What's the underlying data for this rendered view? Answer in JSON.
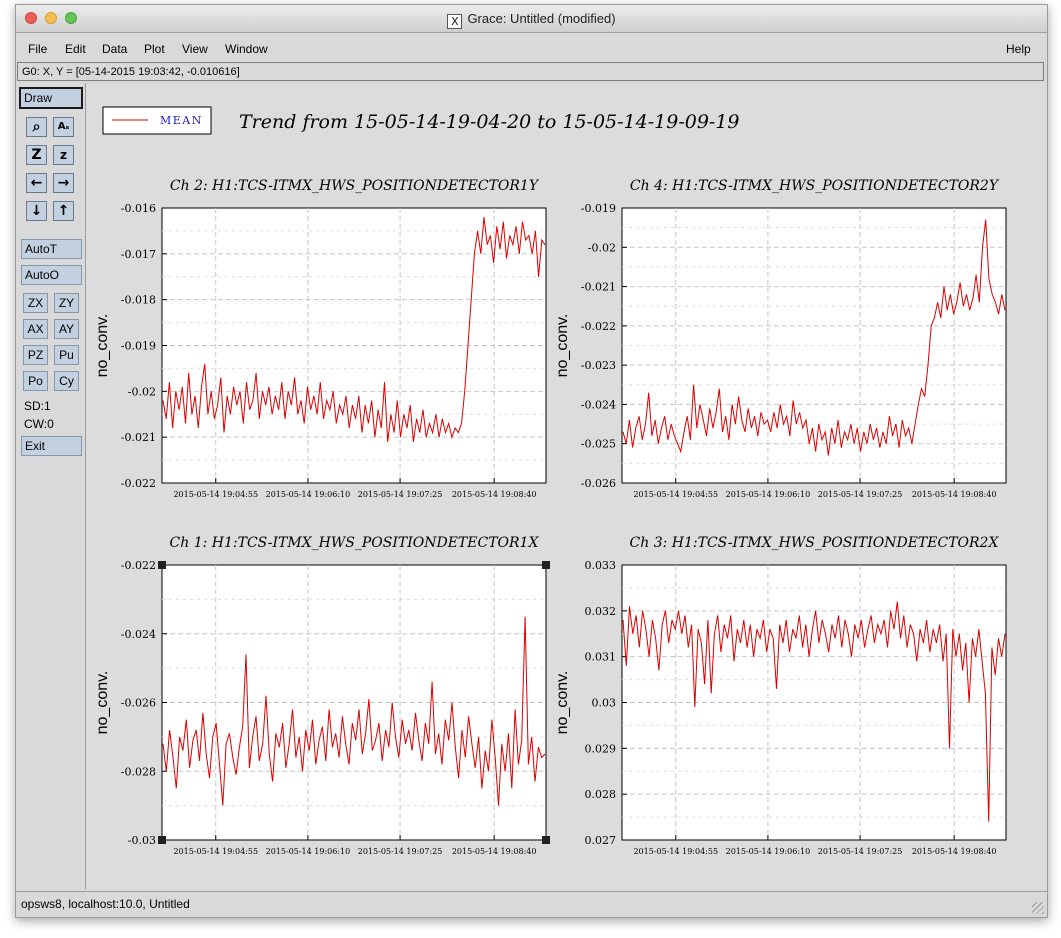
{
  "window": {
    "title": "Grace: Untitled (modified)"
  },
  "menu": {
    "file": "File",
    "edit": "Edit",
    "data": "Data",
    "plot": "Plot",
    "view": "View",
    "window": "Window",
    "help": "Help"
  },
  "coord_readout": "G0: X, Y = [05-14-2015 19:03:42, -0.010616]",
  "toolbar": {
    "draw": "Draw",
    "icons": [
      "zoom-icon",
      "autoscale-text-icon",
      "zoom-z-icon",
      "zoom-z-small-icon",
      "arrow-left-icon",
      "arrow-right-icon",
      "arrow-down-icon",
      "arrow-up-icon"
    ],
    "autot": "AutoT",
    "autoo": "AutoO",
    "zx": "ZX",
    "zy": "ZY",
    "ax": "AX",
    "ay": "AY",
    "pz": "PZ",
    "pu": "Pu",
    "po": "Po",
    "cy": "Cy",
    "sd": "SD:1",
    "cw": "CW:0",
    "exit": "Exit"
  },
  "legend": {
    "entry": "MEAN",
    "line_color": "#cc0000"
  },
  "page_title": "Trend from 15-05-14-19-04-20 to 15-05-14-19-09-19",
  "status": "opsws8, localhost:10.0, Untitled",
  "colors": {
    "series": "#dd0000",
    "legend_text": "#1a1acc",
    "button": "#c2d0e0"
  },
  "chart_data": [
    {
      "type": "line",
      "title": "Ch 2: H1:TCS-ITMX_HWS_POSITIONDETECTOR1Y",
      "ylabel": "no_conv.",
      "ylim": [
        -0.022,
        -0.016
      ],
      "yticks": [
        "-0.016",
        "-0.017",
        "-0.018",
        "-0.019",
        "-0.02",
        "-0.021",
        "-0.022"
      ],
      "xticks": [
        "2015-05-14 19:04:55",
        "2015-05-14 19:06:10",
        "2015-05-14 19:07:25",
        "2015-05-14 19:08:40"
      ],
      "series": [
        {
          "values": [
            -0.0202,
            -0.0206,
            -0.0198,
            -0.0208,
            -0.02,
            -0.0204,
            -0.0199,
            -0.0207,
            -0.0196,
            -0.0205,
            -0.0201,
            -0.0208,
            -0.0199,
            -0.0194,
            -0.0205,
            -0.02,
            -0.0206,
            -0.0203,
            -0.0197,
            -0.0209,
            -0.0201,
            -0.0205,
            -0.0199,
            -0.0203,
            -0.02,
            -0.0207,
            -0.0198,
            -0.0204,
            -0.0202,
            -0.0196,
            -0.0206,
            -0.02,
            -0.0203,
            -0.0199,
            -0.0205,
            -0.0201,
            -0.0204,
            -0.0198,
            -0.0206,
            -0.02,
            -0.0203,
            -0.0197,
            -0.0205,
            -0.0202,
            -0.0207,
            -0.0199,
            -0.0204,
            -0.0201,
            -0.0205,
            -0.0198,
            -0.0206,
            -0.0202,
            -0.0204,
            -0.02,
            -0.0207,
            -0.0203,
            -0.0205,
            -0.0201,
            -0.0208,
            -0.0203,
            -0.0206,
            -0.0201,
            -0.0209,
            -0.0203,
            -0.0207,
            -0.0202,
            -0.021,
            -0.0204,
            -0.0208,
            -0.0198,
            -0.0211,
            -0.0205,
            -0.0209,
            -0.0202,
            -0.021,
            -0.0205,
            -0.0208,
            -0.0203,
            -0.0211,
            -0.0206,
            -0.0209,
            -0.0204,
            -0.021,
            -0.0207,
            -0.0209,
            -0.0205,
            -0.021,
            -0.0206,
            -0.0209,
            -0.0207,
            -0.021,
            -0.0208,
            -0.0209,
            -0.0207,
            -0.02,
            -0.019,
            -0.018,
            -0.017,
            -0.0165,
            -0.017,
            -0.0162,
            -0.0168,
            -0.0166,
            -0.0172,
            -0.0164,
            -0.0169,
            -0.0163,
            -0.0171,
            -0.0166,
            -0.0168,
            -0.0164,
            -0.017,
            -0.0163,
            -0.0167,
            -0.0166,
            -0.017,
            -0.0165,
            -0.0175,
            -0.0167,
            -0.0168
          ]
        }
      ]
    },
    {
      "type": "line",
      "title": "Ch 4: H1:TCS-ITMX_HWS_POSITIONDETECTOR2Y",
      "ylabel": "no_conv.",
      "ylim": [
        -0.026,
        -0.019
      ],
      "yticks": [
        "-0.019",
        "-0.02",
        "-0.021",
        "-0.022",
        "-0.023",
        "-0.024",
        "-0.025",
        "-0.026"
      ],
      "xticks": [
        "2015-05-14 19:04:55",
        "2015-05-14 19:06:10",
        "2015-05-14 19:07:25",
        "2015-05-14 19:08:40"
      ],
      "series": [
        {
          "values": [
            -0.0247,
            -0.025,
            -0.0244,
            -0.0251,
            -0.0246,
            -0.0243,
            -0.0249,
            -0.0245,
            -0.0237,
            -0.0248,
            -0.0244,
            -0.025,
            -0.0246,
            -0.0243,
            -0.0249,
            -0.0245,
            -0.0248,
            -0.025,
            -0.0252,
            -0.0247,
            -0.0243,
            -0.0249,
            -0.0235,
            -0.0246,
            -0.024,
            -0.0244,
            -0.0248,
            -0.0241,
            -0.0246,
            -0.0242,
            -0.0236,
            -0.0247,
            -0.0243,
            -0.0249,
            -0.024,
            -0.0245,
            -0.0238,
            -0.0244,
            -0.0247,
            -0.0241,
            -0.0246,
            -0.0243,
            -0.0248,
            -0.0242,
            -0.0245,
            -0.0244,
            -0.0247,
            -0.0242,
            -0.0246,
            -0.024,
            -0.0245,
            -0.0243,
            -0.0248,
            -0.0239,
            -0.0245,
            -0.0242,
            -0.0246,
            -0.0244,
            -0.025,
            -0.0246,
            -0.0252,
            -0.0245,
            -0.0249,
            -0.0247,
            -0.0253,
            -0.0246,
            -0.025,
            -0.0244,
            -0.0251,
            -0.0247,
            -0.0249,
            -0.0245,
            -0.025,
            -0.0246,
            -0.0252,
            -0.0247,
            -0.025,
            -0.0245,
            -0.0249,
            -0.0246,
            -0.0251,
            -0.0247,
            -0.025,
            -0.0243,
            -0.0248,
            -0.0245,
            -0.0251,
            -0.0244,
            -0.0248,
            -0.0246,
            -0.025,
            -0.0245,
            -0.024,
            -0.0236,
            -0.0238,
            -0.023,
            -0.022,
            -0.0218,
            -0.0214,
            -0.0218,
            -0.021,
            -0.0216,
            -0.0212,
            -0.0217,
            -0.0214,
            -0.0209,
            -0.0215,
            -0.0212,
            -0.0216,
            -0.0213,
            -0.0207,
            -0.0214,
            -0.02,
            -0.0193,
            -0.0208,
            -0.0212,
            -0.0214,
            -0.0217,
            -0.0212,
            -0.0216
          ]
        }
      ]
    },
    {
      "type": "line",
      "title": "Ch 1: H1:TCS-ITMX_HWS_POSITIONDETECTOR1X",
      "ylabel": "no_conv.",
      "ylim": [
        -0.03,
        -0.022
      ],
      "yticks": [
        "-0.022",
        "-0.024",
        "-0.026",
        "-0.028",
        "-0.03"
      ],
      "xticks": [
        "2015-05-14 19:04:55",
        "2015-05-14 19:06:10",
        "2015-05-14 19:07:25",
        "2015-05-14 19:08:40"
      ],
      "series": [
        {
          "values": [
            -0.0272,
            -0.028,
            -0.0268,
            -0.0276,
            -0.0285,
            -0.027,
            -0.0274,
            -0.0265,
            -0.0279,
            -0.0271,
            -0.0268,
            -0.0277,
            -0.0263,
            -0.0275,
            -0.0282,
            -0.027,
            -0.0266,
            -0.0278,
            -0.029,
            -0.0272,
            -0.0269,
            -0.0276,
            -0.0281,
            -0.0273,
            -0.0267,
            -0.0246,
            -0.0279,
            -0.027,
            -0.0264,
            -0.0277,
            -0.0272,
            -0.0258,
            -0.0275,
            -0.0283,
            -0.0269,
            -0.0273,
            -0.0266,
            -0.0279,
            -0.0272,
            -0.0262,
            -0.0276,
            -0.027,
            -0.028,
            -0.0268,
            -0.0274,
            -0.0265,
            -0.0278,
            -0.0271,
            -0.0267,
            -0.0277,
            -0.0262,
            -0.0273,
            -0.0269,
            -0.0276,
            -0.0264,
            -0.0272,
            -0.0278,
            -0.0266,
            -0.0271,
            -0.0262,
            -0.0275,
            -0.0269,
            -0.0259,
            -0.0274,
            -0.0271,
            -0.0266,
            -0.0277,
            -0.0268,
            -0.0273,
            -0.026,
            -0.027,
            -0.0276,
            -0.0265,
            -0.0272,
            -0.0268,
            -0.0274,
            -0.0263,
            -0.0271,
            -0.0277,
            -0.0266,
            -0.0272,
            -0.0254,
            -0.0275,
            -0.0269,
            -0.0278,
            -0.0265,
            -0.0271,
            -0.026,
            -0.0273,
            -0.0282,
            -0.0268,
            -0.0276,
            -0.0264,
            -0.0272,
            -0.0279,
            -0.027,
            -0.0285,
            -0.0274,
            -0.028,
            -0.0265,
            -0.0276,
            -0.029,
            -0.0272,
            -0.028,
            -0.0269,
            -0.0285,
            -0.0262,
            -0.0278,
            -0.0271,
            -0.0235,
            -0.0278,
            -0.027,
            -0.0283,
            -0.0273,
            -0.0276,
            -0.0275
          ]
        }
      ]
    },
    {
      "type": "line",
      "title": "Ch 3: H1:TCS-ITMX_HWS_POSITIONDETECTOR2X",
      "ylabel": "no_conv.",
      "ylim": [
        0.027,
        0.033
      ],
      "yticks": [
        "0.033",
        "0.032",
        "0.031",
        "0.03",
        "0.029",
        "0.028",
        "0.027"
      ],
      "xticks": [
        "2015-05-14 19:04:55",
        "2015-05-14 19:06:10",
        "2015-05-14 19:07:25",
        "2015-05-14 19:08:40"
      ],
      "series": [
        {
          "values": [
            0.0318,
            0.0308,
            0.0321,
            0.0315,
            0.0319,
            0.0312,
            0.032,
            0.0316,
            0.031,
            0.0318,
            0.0314,
            0.0307,
            0.0317,
            0.032,
            0.0313,
            0.0318,
            0.0316,
            0.032,
            0.0315,
            0.0319,
            0.0312,
            0.0317,
            0.0299,
            0.0316,
            0.0313,
            0.0304,
            0.0318,
            0.0302,
            0.0315,
            0.0319,
            0.0311,
            0.0317,
            0.0314,
            0.0319,
            0.0309,
            0.0316,
            0.0313,
            0.0318,
            0.0312,
            0.0317,
            0.031,
            0.0316,
            0.0314,
            0.0318,
            0.0311,
            0.0316,
            0.0314,
            0.0303,
            0.0317,
            0.0313,
            0.0318,
            0.0311,
            0.0316,
            0.0314,
            0.0319,
            0.0312,
            0.0317,
            0.031,
            0.0316,
            0.032,
            0.0313,
            0.0318,
            0.0315,
            0.0311,
            0.0317,
            0.0314,
            0.0319,
            0.0312,
            0.0318,
            0.0315,
            0.031,
            0.0317,
            0.0314,
            0.0318,
            0.0312,
            0.0316,
            0.0319,
            0.0313,
            0.0317,
            0.0315,
            0.0318,
            0.0312,
            0.032,
            0.0316,
            0.0322,
            0.0314,
            0.0319,
            0.0312,
            0.0317,
            0.0315,
            0.0309,
            0.0316,
            0.0313,
            0.0318,
            0.0311,
            0.0316,
            0.0313,
            0.0317,
            0.0309,
            0.0315,
            0.029,
            0.0316,
            0.031,
            0.0315,
            0.0307,
            0.0313,
            0.03,
            0.0314,
            0.031,
            0.0316,
            0.0309,
            0.0302,
            0.0274,
            0.0312,
            0.0306,
            0.0314,
            0.031,
            0.0315
          ]
        }
      ]
    }
  ]
}
